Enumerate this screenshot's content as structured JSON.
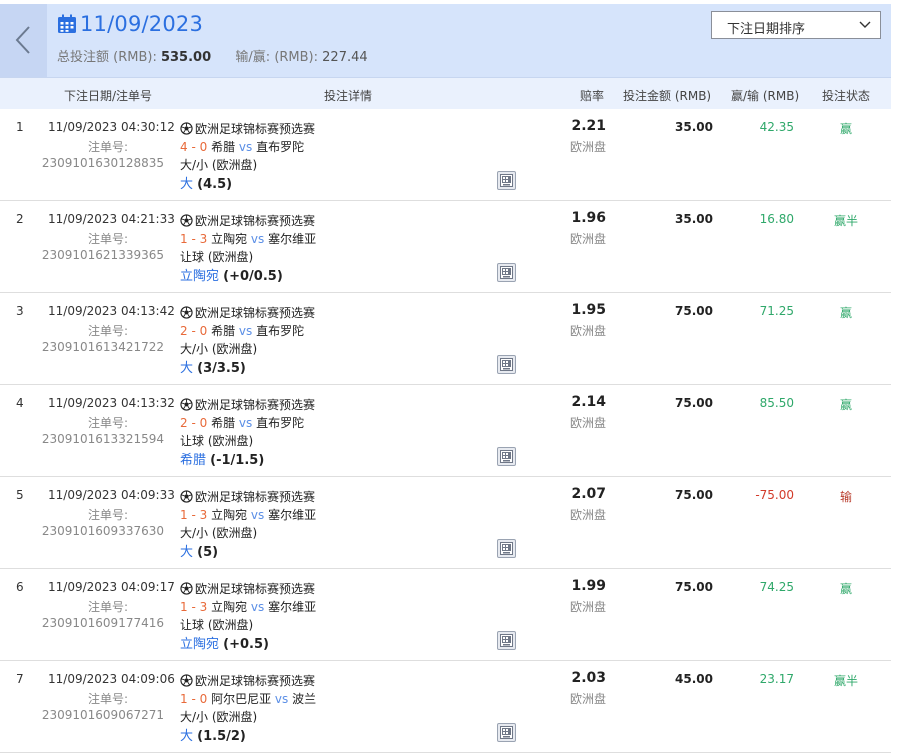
{
  "header": {
    "date": "11/09/2023",
    "total_label": "总投注额 (RMB):",
    "total_value": "535.00",
    "winloss_label": "输/赢: (RMB):",
    "winloss_value": "227.44",
    "sort_value": "下注日期排序",
    "icons": {
      "back": "chevron-left-icon",
      "calendar": "calendar-icon",
      "dropdown": "chevron-down-icon"
    }
  },
  "columns": {
    "date_order": "下注日期/注单号",
    "detail": "投注详情",
    "odds": "赔率",
    "stake": "投注金额 (RMB)",
    "winloss": "赢/输 (RMB)",
    "status": "投注状态"
  },
  "colors": {
    "accent": "#2b6fe0",
    "header_bg": "#d6e4fb",
    "win": "#2fa86a",
    "lose": "#d23b2a",
    "score": "#e86a3a"
  },
  "rows": [
    {
      "idx": "1",
      "datetime": "11/09/2023 04:30:12",
      "order_label": "注单号:",
      "order_no": "2309101630128835",
      "league": "欧洲足球锦标赛预选赛",
      "score": "4 - 0",
      "home": "希腊",
      "vs": "vs",
      "away": "直布罗陀",
      "bet_type": "大/小 (欧洲盘)",
      "selection": "大",
      "handicap": "(4.5)",
      "odds": "2.21",
      "odds_type": "欧洲盘",
      "stake": "35.00",
      "winloss": "42.35",
      "status": "赢",
      "result": "win"
    },
    {
      "idx": "2",
      "datetime": "11/09/2023 04:21:33",
      "order_label": "注单号:",
      "order_no": "2309101621339365",
      "league": "欧洲足球锦标赛预选赛",
      "score": "1 - 3",
      "home": "立陶宛",
      "vs": "vs",
      "away": "塞尔维亚",
      "bet_type": "让球 (欧洲盘)",
      "selection": "立陶宛",
      "handicap": "(+0/0.5)",
      "odds": "1.96",
      "odds_type": "欧洲盘",
      "stake": "35.00",
      "winloss": "16.80",
      "status": "赢半",
      "result": "win"
    },
    {
      "idx": "3",
      "datetime": "11/09/2023 04:13:42",
      "order_label": "注单号:",
      "order_no": "2309101613421722",
      "league": "欧洲足球锦标赛预选赛",
      "score": "2 - 0",
      "home": "希腊",
      "vs": "vs",
      "away": "直布罗陀",
      "bet_type": "大/小 (欧洲盘)",
      "selection": "大",
      "handicap": "(3/3.5)",
      "odds": "1.95",
      "odds_type": "欧洲盘",
      "stake": "75.00",
      "winloss": "71.25",
      "status": "赢",
      "result": "win"
    },
    {
      "idx": "4",
      "datetime": "11/09/2023 04:13:32",
      "order_label": "注单号:",
      "order_no": "2309101613321594",
      "league": "欧洲足球锦标赛预选赛",
      "score": "2 - 0",
      "home": "希腊",
      "vs": "vs",
      "away": "直布罗陀",
      "bet_type": "让球 (欧洲盘)",
      "selection": "希腊",
      "handicap": "(-1/1.5)",
      "odds": "2.14",
      "odds_type": "欧洲盘",
      "stake": "75.00",
      "winloss": "85.50",
      "status": "赢",
      "result": "win"
    },
    {
      "idx": "5",
      "datetime": "11/09/2023 04:09:33",
      "order_label": "注单号:",
      "order_no": "2309101609337630",
      "league": "欧洲足球锦标赛预选赛",
      "score": "1 - 3",
      "home": "立陶宛",
      "vs": "vs",
      "away": "塞尔维亚",
      "bet_type": "大/小 (欧洲盘)",
      "selection": "大",
      "handicap": "(5)",
      "odds": "2.07",
      "odds_type": "欧洲盘",
      "stake": "75.00",
      "winloss": "-75.00",
      "status": "输",
      "result": "lose"
    },
    {
      "idx": "6",
      "datetime": "11/09/2023 04:09:17",
      "order_label": "注单号:",
      "order_no": "2309101609177416",
      "league": "欧洲足球锦标赛预选赛",
      "score": "1 - 3",
      "home": "立陶宛",
      "vs": "vs",
      "away": "塞尔维亚",
      "bet_type": "让球 (欧洲盘)",
      "selection": "立陶宛",
      "handicap": "(+0.5)",
      "odds": "1.99",
      "odds_type": "欧洲盘",
      "stake": "75.00",
      "winloss": "74.25",
      "status": "赢",
      "result": "win"
    },
    {
      "idx": "7",
      "datetime": "11/09/2023 04:09:06",
      "order_label": "注单号:",
      "order_no": "2309101609067271",
      "league": "欧洲足球锦标赛预选赛",
      "score": "1 - 0",
      "home": "阿尔巴尼亚",
      "vs": "vs",
      "away": "波兰",
      "bet_type": "大/小 (欧洲盘)",
      "selection": "大",
      "handicap": "(1.5/2)",
      "odds": "2.03",
      "odds_type": "欧洲盘",
      "stake": "45.00",
      "winloss": "23.17",
      "status": "赢半",
      "result": "win"
    }
  ]
}
